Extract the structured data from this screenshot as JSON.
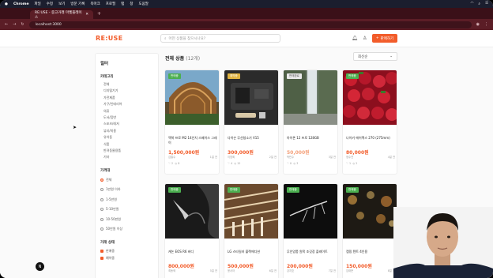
{
  "mac_menu": {
    "app": "Chrome",
    "items": [
      "파일",
      "수정",
      "보기",
      "방문 기록",
      "북마크",
      "프로필",
      "탭",
      "창",
      "도움말"
    ]
  },
  "browser": {
    "tab_title": "RE:USE - 중고거래 마켓플레이스",
    "url": "localhost:3000"
  },
  "site": {
    "logo": "RE:USE",
    "search_placeholder": "어떤 상품을 찾으시나요?",
    "sell_label": "판매하기"
  },
  "sidebar": {
    "title": "필터",
    "category_title": "카테고리",
    "categories": [
      "전체",
      "디지털기기",
      "가전제품",
      "가구/인테리어",
      "의류",
      "도서/음반",
      "스포츠/레저",
      "뷰티/미용",
      "유아동",
      "식품",
      "반려동물용품",
      "기타"
    ],
    "price_title": "가격대",
    "prices": [
      "전체",
      "1만원 이하",
      "1-5만원",
      "5-10만원",
      "10-50만원",
      "50만원 이상"
    ],
    "condition_title": "거래 상태",
    "conditions": [
      "판매중",
      "예약중"
    ]
  },
  "main": {
    "heading": "전체 상품",
    "count": "(12개)",
    "sort": "최신순"
  },
  "products": [
    {
      "badge": "판매중",
      "title": "맥북 프로 M2 14인치 스페이스 그레이",
      "price": "1,500,000원",
      "seller": "김철수",
      "time": "1일 전",
      "likes": "2",
      "views": "8"
    },
    {
      "badge": "예약중",
      "title": "다이슨 무선청소기 V15",
      "price": "300,000원",
      "seller": "이영희",
      "time": "2일 전",
      "likes": "4",
      "views": "12"
    },
    {
      "badge": "판매완료",
      "title": "아이폰 12 프로 128GB",
      "price": "50,000원",
      "seller": "박민수",
      "time": "3일 전",
      "likes": "0",
      "views": "3"
    },
    {
      "badge": "판매중",
      "title": "나이키 에어맥스 270 (275mm)",
      "price": "80,000원",
      "seller": "정수연",
      "time": "4일 전",
      "likes": "1",
      "views": "2"
    },
    {
      "badge": "판매중",
      "title": "캐논 EOS R6 바디",
      "price": "800,000원",
      "seller": "최동혁",
      "time": "5일 전",
      "likes": "3",
      "views": "7"
    },
    {
      "badge": "판매중",
      "title": "LG 스타일러 블랙에디션",
      "price": "500,000원",
      "seller": "윤서아",
      "time": "6일 전",
      "likes": "2",
      "views": "5"
    },
    {
      "badge": "판매중",
      "title": "무인양품 원목 조깃장 플레이트",
      "price": "200,000원",
      "seller": "강지호",
      "time": "7일 전",
      "likes": "1",
      "views": "4"
    },
    {
      "badge": "판매중",
      "title": "캠핑 텐트 4인용",
      "price": "150,000원",
      "seller": "임태준",
      "time": "8일 전",
      "likes": "0",
      "views": "6"
    }
  ]
}
